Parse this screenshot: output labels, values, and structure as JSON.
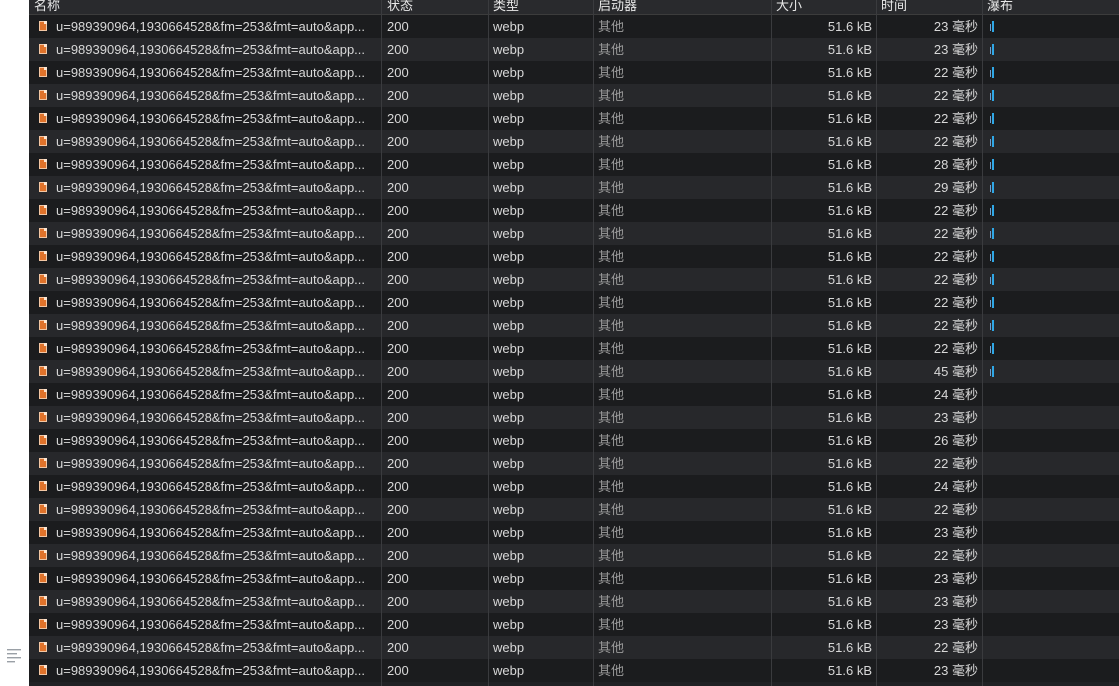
{
  "columns": {
    "name": "名称",
    "status": "状态",
    "type": "类型",
    "initiator": "启动器",
    "size": "大小",
    "time": "时间",
    "waterfall": "瀑布"
  },
  "rows": [
    {
      "name": "u=989390964,1930664528&fm=253&fmt=auto&app...",
      "status": "200",
      "type": "webp",
      "initiator": "其他",
      "size": "51.6 kB",
      "time": "23 毫秒",
      "waterfall": true
    },
    {
      "name": "u=989390964,1930664528&fm=253&fmt=auto&app...",
      "status": "200",
      "type": "webp",
      "initiator": "其他",
      "size": "51.6 kB",
      "time": "23 毫秒",
      "waterfall": true
    },
    {
      "name": "u=989390964,1930664528&fm=253&fmt=auto&app...",
      "status": "200",
      "type": "webp",
      "initiator": "其他",
      "size": "51.6 kB",
      "time": "22 毫秒",
      "waterfall": true
    },
    {
      "name": "u=989390964,1930664528&fm=253&fmt=auto&app...",
      "status": "200",
      "type": "webp",
      "initiator": "其他",
      "size": "51.6 kB",
      "time": "22 毫秒",
      "waterfall": true
    },
    {
      "name": "u=989390964,1930664528&fm=253&fmt=auto&app...",
      "status": "200",
      "type": "webp",
      "initiator": "其他",
      "size": "51.6 kB",
      "time": "22 毫秒",
      "waterfall": true
    },
    {
      "name": "u=989390964,1930664528&fm=253&fmt=auto&app...",
      "status": "200",
      "type": "webp",
      "initiator": "其他",
      "size": "51.6 kB",
      "time": "22 毫秒",
      "waterfall": true
    },
    {
      "name": "u=989390964,1930664528&fm=253&fmt=auto&app...",
      "status": "200",
      "type": "webp",
      "initiator": "其他",
      "size": "51.6 kB",
      "time": "28 毫秒",
      "waterfall": true
    },
    {
      "name": "u=989390964,1930664528&fm=253&fmt=auto&app...",
      "status": "200",
      "type": "webp",
      "initiator": "其他",
      "size": "51.6 kB",
      "time": "29 毫秒",
      "waterfall": true
    },
    {
      "name": "u=989390964,1930664528&fm=253&fmt=auto&app...",
      "status": "200",
      "type": "webp",
      "initiator": "其他",
      "size": "51.6 kB",
      "time": "22 毫秒",
      "waterfall": true
    },
    {
      "name": "u=989390964,1930664528&fm=253&fmt=auto&app...",
      "status": "200",
      "type": "webp",
      "initiator": "其他",
      "size": "51.6 kB",
      "time": "22 毫秒",
      "waterfall": true
    },
    {
      "name": "u=989390964,1930664528&fm=253&fmt=auto&app...",
      "status": "200",
      "type": "webp",
      "initiator": "其他",
      "size": "51.6 kB",
      "time": "22 毫秒",
      "waterfall": true
    },
    {
      "name": "u=989390964,1930664528&fm=253&fmt=auto&app...",
      "status": "200",
      "type": "webp",
      "initiator": "其他",
      "size": "51.6 kB",
      "time": "22 毫秒",
      "waterfall": true
    },
    {
      "name": "u=989390964,1930664528&fm=253&fmt=auto&app...",
      "status": "200",
      "type": "webp",
      "initiator": "其他",
      "size": "51.6 kB",
      "time": "22 毫秒",
      "waterfall": true
    },
    {
      "name": "u=989390964,1930664528&fm=253&fmt=auto&app...",
      "status": "200",
      "type": "webp",
      "initiator": "其他",
      "size": "51.6 kB",
      "time": "22 毫秒",
      "waterfall": true
    },
    {
      "name": "u=989390964,1930664528&fm=253&fmt=auto&app...",
      "status": "200",
      "type": "webp",
      "initiator": "其他",
      "size": "51.6 kB",
      "time": "22 毫秒",
      "waterfall": true
    },
    {
      "name": "u=989390964,1930664528&fm=253&fmt=auto&app...",
      "status": "200",
      "type": "webp",
      "initiator": "其他",
      "size": "51.6 kB",
      "time": "45 毫秒",
      "waterfall": true
    },
    {
      "name": "u=989390964,1930664528&fm=253&fmt=auto&app...",
      "status": "200",
      "type": "webp",
      "initiator": "其他",
      "size": "51.6 kB",
      "time": "24 毫秒",
      "waterfall": false
    },
    {
      "name": "u=989390964,1930664528&fm=253&fmt=auto&app...",
      "status": "200",
      "type": "webp",
      "initiator": "其他",
      "size": "51.6 kB",
      "time": "23 毫秒",
      "waterfall": false
    },
    {
      "name": "u=989390964,1930664528&fm=253&fmt=auto&app...",
      "status": "200",
      "type": "webp",
      "initiator": "其他",
      "size": "51.6 kB",
      "time": "26 毫秒",
      "waterfall": false
    },
    {
      "name": "u=989390964,1930664528&fm=253&fmt=auto&app...",
      "status": "200",
      "type": "webp",
      "initiator": "其他",
      "size": "51.6 kB",
      "time": "22 毫秒",
      "waterfall": false
    },
    {
      "name": "u=989390964,1930664528&fm=253&fmt=auto&app...",
      "status": "200",
      "type": "webp",
      "initiator": "其他",
      "size": "51.6 kB",
      "time": "24 毫秒",
      "waterfall": false
    },
    {
      "name": "u=989390964,1930664528&fm=253&fmt=auto&app...",
      "status": "200",
      "type": "webp",
      "initiator": "其他",
      "size": "51.6 kB",
      "time": "22 毫秒",
      "waterfall": false
    },
    {
      "name": "u=989390964,1930664528&fm=253&fmt=auto&app...",
      "status": "200",
      "type": "webp",
      "initiator": "其他",
      "size": "51.6 kB",
      "time": "23 毫秒",
      "waterfall": false
    },
    {
      "name": "u=989390964,1930664528&fm=253&fmt=auto&app...",
      "status": "200",
      "type": "webp",
      "initiator": "其他",
      "size": "51.6 kB",
      "time": "22 毫秒",
      "waterfall": false
    },
    {
      "name": "u=989390964,1930664528&fm=253&fmt=auto&app...",
      "status": "200",
      "type": "webp",
      "initiator": "其他",
      "size": "51.6 kB",
      "time": "23 毫秒",
      "waterfall": false
    },
    {
      "name": "u=989390964,1930664528&fm=253&fmt=auto&app...",
      "status": "200",
      "type": "webp",
      "initiator": "其他",
      "size": "51.6 kB",
      "time": "23 毫秒",
      "waterfall": false
    },
    {
      "name": "u=989390964,1930664528&fm=253&fmt=auto&app...",
      "status": "200",
      "type": "webp",
      "initiator": "其他",
      "size": "51.6 kB",
      "time": "23 毫秒",
      "waterfall": false
    },
    {
      "name": "u=989390964,1930664528&fm=253&fmt=auto&app...",
      "status": "200",
      "type": "webp",
      "initiator": "其他",
      "size": "51.6 kB",
      "time": "22 毫秒",
      "waterfall": false
    },
    {
      "name": "u=989390964,1930664528&fm=253&fmt=auto&app...",
      "status": "200",
      "type": "webp",
      "initiator": "其他",
      "size": "51.6 kB",
      "time": "23 毫秒",
      "waterfall": false
    }
  ],
  "icons": {
    "file": "webp-file-icon",
    "waterfall_bar": "waterfall-timing-bar"
  },
  "colors": {
    "background": "#202124",
    "row_alt": "#27282b",
    "file_icon": "#e0732b",
    "waterfall": "#2fa7e6"
  }
}
